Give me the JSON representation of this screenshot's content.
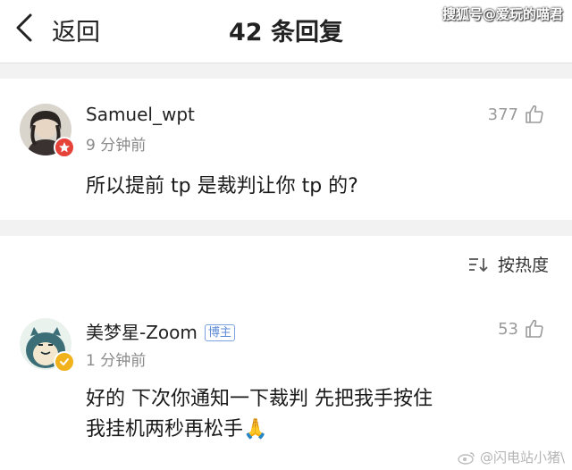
{
  "header": {
    "back_label": "返回",
    "title": "42 条回复",
    "watermark": "搜狐号@爱玩的喵君"
  },
  "comments": [
    {
      "username": "Samuel_wpt",
      "time": "9 分钟前",
      "text": "所以提前 tp 是裁判让你 tp 的?",
      "likes": "377",
      "badge_color": "#e5423a"
    },
    {
      "username": "美梦星-Zoom",
      "tag": "博主",
      "time": "1 分钟前",
      "text_line1": "好的  下次你通知一下裁判  先把我手按住",
      "text_line2": "我挂机两秒再松手🙏",
      "likes": "53",
      "badge_color": "#f2b21c"
    }
  ],
  "sort": {
    "label": "按热度"
  },
  "footer_watermark": "@闪电站小猪\\"
}
